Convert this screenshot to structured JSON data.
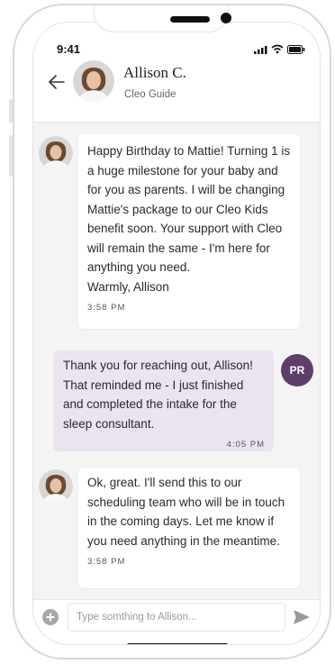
{
  "status_bar": {
    "time": "9:41"
  },
  "header": {
    "name": "Allison C.",
    "role": "Cleo Guide"
  },
  "messages": [
    {
      "sender": "guide",
      "text": "Happy Birthday to Mattie! Turning 1 is a huge milestone for your baby and for you as parents. I will be changing Mattie's package to our Cleo Kids benefit soon. Your support with Cleo will remain the same - I'm here for anything you need.\nWarmly, Allison",
      "time": "3:58 PM"
    },
    {
      "sender": "user",
      "initials": "PR",
      "text": "Thank you for reaching out, Allison! That reminded me - I just finished and completed the intake for the sleep consultant.",
      "time": "4:05 PM"
    },
    {
      "sender": "guide",
      "text": "Ok, great. I'll send this to our scheduling team who will be in touch in the coming days. Let me know if you need anything in the meantime.",
      "time": "3:58 PM"
    }
  ],
  "composer": {
    "placeholder": "Type somthing to Allison..."
  },
  "colors": {
    "accent": "#5d3f6a",
    "user_bubble": "#ebe3ef",
    "background": "#f4f4f4"
  }
}
